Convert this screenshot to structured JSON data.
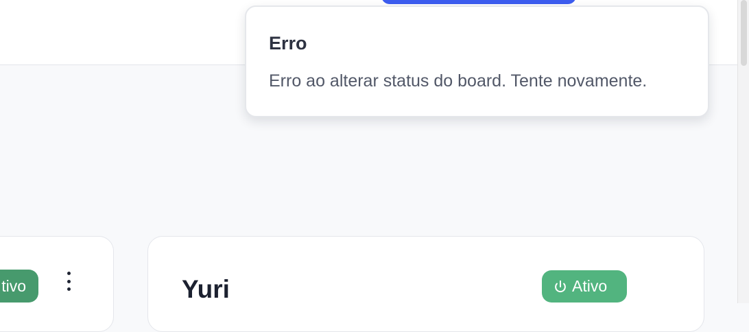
{
  "toast": {
    "title": "Erro",
    "message": "Erro ao alterar status do board. Tente novamente."
  },
  "boards": [
    {
      "status_label": "tivo",
      "status_color": "#479a6d"
    },
    {
      "name": "Yuri",
      "status_label": "Ativo",
      "status_color": "#52b47f"
    }
  ],
  "colors": {
    "accent": "#3d5df0",
    "background": "#f8f9fb"
  },
  "icons": {
    "status": "power-icon",
    "menu": "more-vertical-icon"
  }
}
